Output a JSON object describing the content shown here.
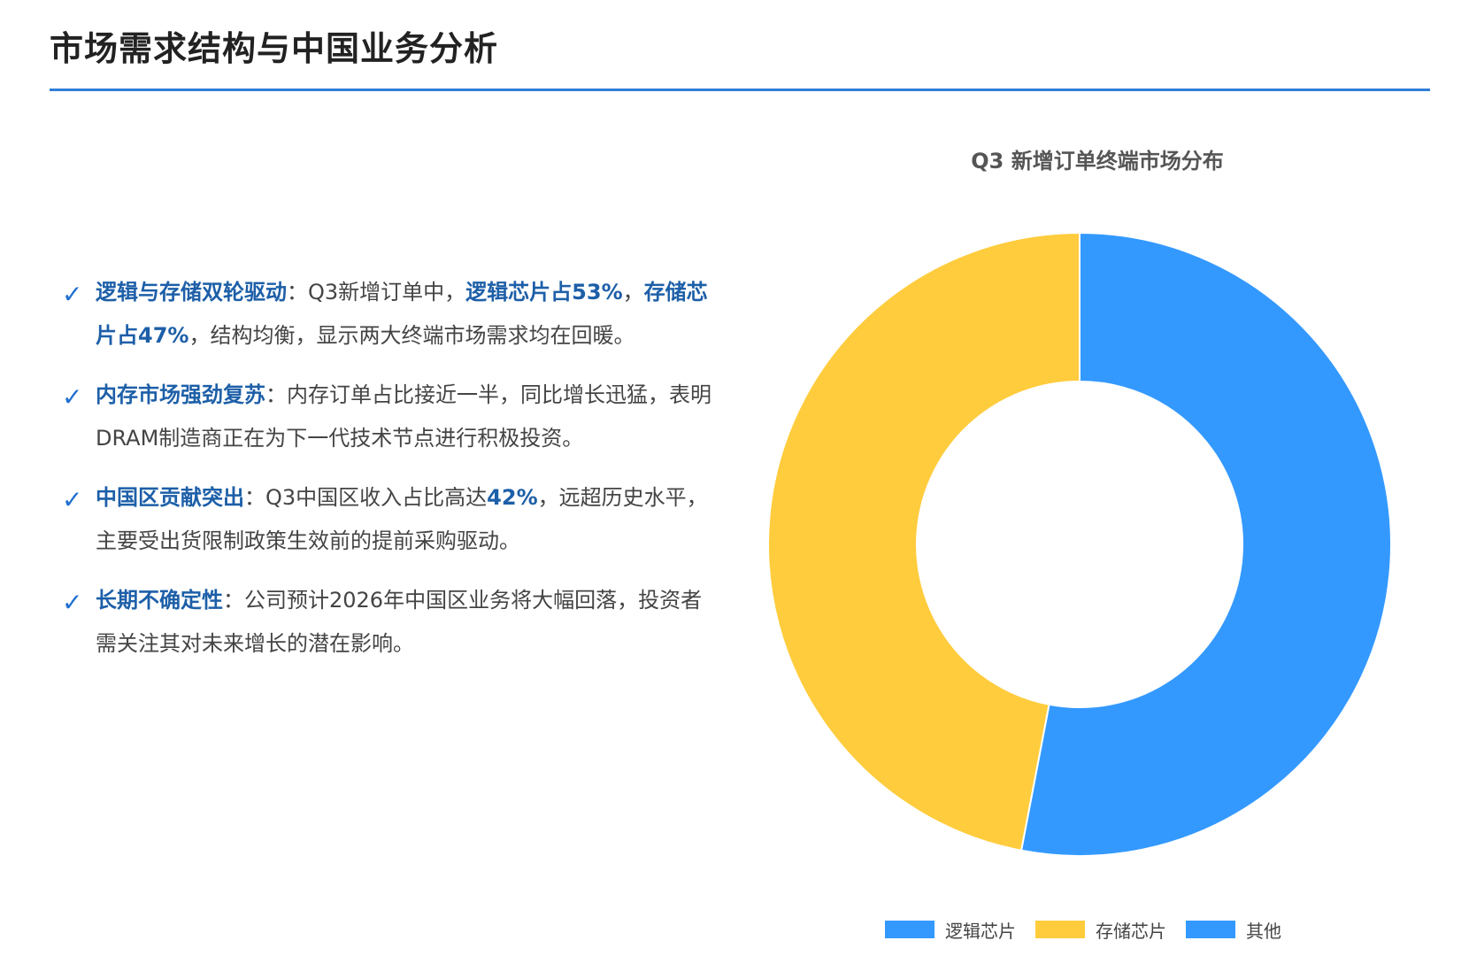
{
  "page": {
    "title": "市场需求结构与中国业务分析",
    "accent_color": "#2f7ed8"
  },
  "points": [
    {
      "icon": "check-icon",
      "runs": [
        {
          "text": "逻辑与存储双轮驱动",
          "hl": true
        },
        {
          "text": "：Q3新增订单中，",
          "hl": false
        },
        {
          "text": "逻辑芯片占53%",
          "hl": true
        },
        {
          "text": "，",
          "hl": false
        },
        {
          "text": "存储芯片占47%",
          "hl": true
        },
        {
          "text": "，结构均衡，显示两大终端市场需求均在回暖。",
          "hl": false
        }
      ]
    },
    {
      "icon": "check-icon",
      "runs": [
        {
          "text": "内存市场强劲复苏",
          "hl": true
        },
        {
          "text": "：内存订单占比接近一半，同比增长迅猛，表明DRAM制造商正在为下一代技术节点进行积极投资。",
          "hl": false
        }
      ]
    },
    {
      "icon": "check-icon",
      "runs": [
        {
          "text": "中国区贡献突出",
          "hl": true
        },
        {
          "text": "：Q3中国区收入占比高达",
          "hl": false
        },
        {
          "text": "42%",
          "hl": true
        },
        {
          "text": "，远超历史水平，主要受出货限制政策生效前的提前采购驱动。",
          "hl": false
        }
      ]
    },
    {
      "icon": "check-icon",
      "runs": [
        {
          "text": "长期不确定性",
          "hl": true
        },
        {
          "text": "：公司预计2026年中国区业务将大幅回落，投资者需关注其对未来增长的潜在影响。",
          "hl": false
        }
      ]
    }
  ],
  "chart_data": {
    "type": "pie",
    "title": "Q3 新增订单终端市场分布",
    "donut": true,
    "categories": [
      "逻辑芯片",
      "存储芯片",
      "其他"
    ],
    "values": [
      53,
      47,
      0
    ],
    "colors": [
      "#3399ff",
      "#ffcc3d",
      "#3399ff"
    ],
    "legend_position": "bottom"
  }
}
